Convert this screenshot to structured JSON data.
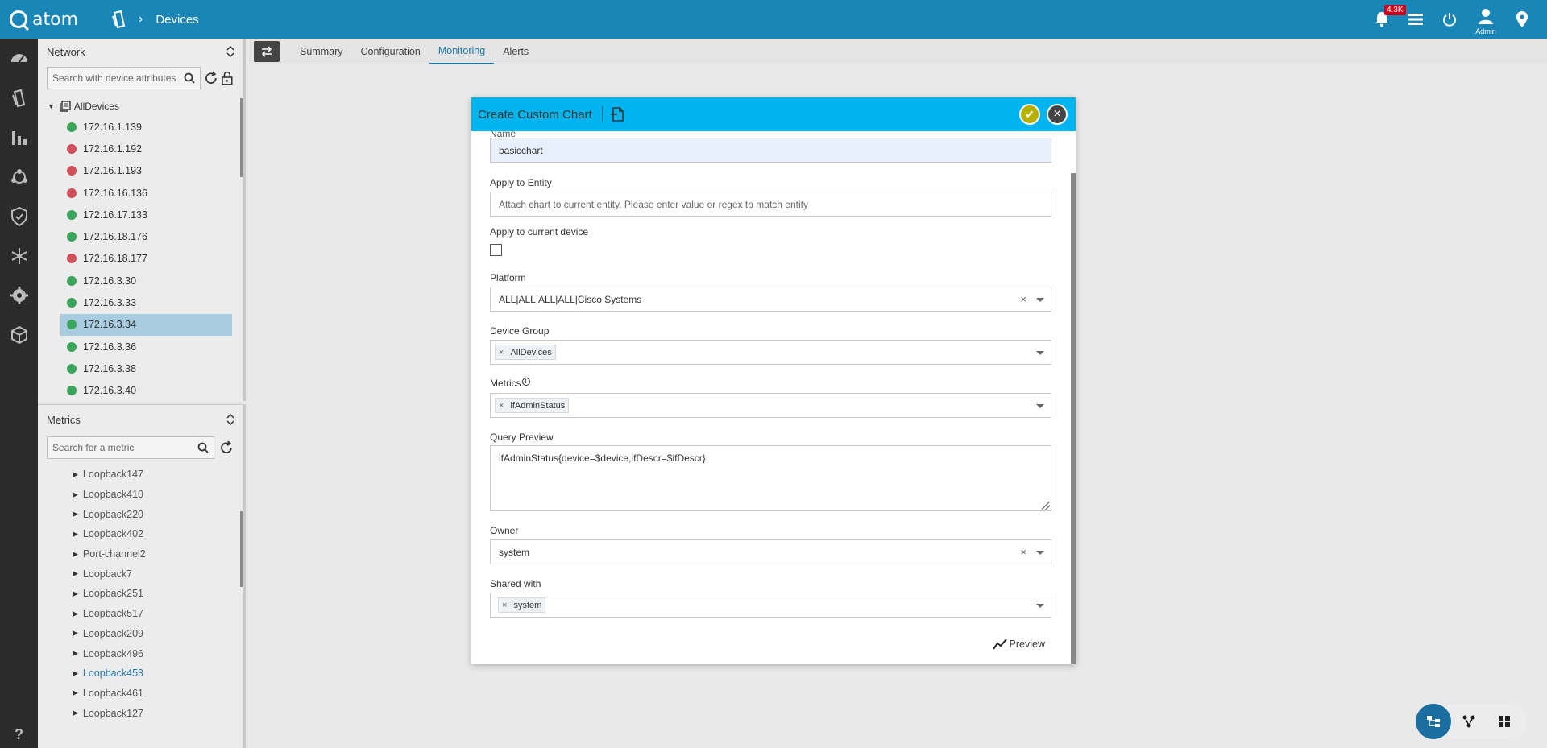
{
  "topbar": {
    "app_name": "atom",
    "breadcrumb": "Devices",
    "notification_count": "4.3K",
    "user_label": "Admin",
    "bg_color": "#1a86b8"
  },
  "network_panel": {
    "title": "Network",
    "search_placeholder": "Search with device attributes",
    "root_label": "AllDevices",
    "devices": [
      {
        "ip": "172.16.1.139",
        "status": "green"
      },
      {
        "ip": "172.16.1.192",
        "status": "red"
      },
      {
        "ip": "172.16.1.193",
        "status": "red"
      },
      {
        "ip": "172.16.16.136",
        "status": "red"
      },
      {
        "ip": "172.16.17.133",
        "status": "green"
      },
      {
        "ip": "172.16.18.176",
        "status": "green"
      },
      {
        "ip": "172.16.18.177",
        "status": "red"
      },
      {
        "ip": "172.16.3.30",
        "status": "green"
      },
      {
        "ip": "172.16.3.33",
        "status": "green"
      },
      {
        "ip": "172.16.3.34",
        "status": "green",
        "selected": true
      },
      {
        "ip": "172.16.3.36",
        "status": "green"
      },
      {
        "ip": "172.16.3.38",
        "status": "green"
      },
      {
        "ip": "172.16.3.40",
        "status": "green"
      }
    ]
  },
  "metrics_panel": {
    "title": "Metrics",
    "search_placeholder": "Search for a metric",
    "items": [
      "Loopback147",
      "Loopback410",
      "Loopback220",
      "Loopback402",
      "Port-channel2",
      "Loopback7",
      "Loopback251",
      "Loopback517",
      "Loopback209",
      "Loopback496",
      "Loopback453",
      "Loopback461",
      "Loopback127"
    ],
    "active_item": "Loopback453"
  },
  "tabs": [
    "Summary",
    "Configuration",
    "Monitoring",
    "Alerts"
  ],
  "active_tab": "Monitoring",
  "modal": {
    "title": "Create Custom Chart",
    "name_label": "Name",
    "name_value": "basicchart",
    "entity_label": "Apply to Entity",
    "entity_placeholder": "Attach chart to current entity. Please enter value or regex to match entity",
    "current_device_label": "Apply to current device",
    "platform_label": "Platform",
    "platform_value": "ALL|ALL|ALL|ALL|Cisco Systems",
    "device_group_label": "Device Group",
    "device_group_tag": "AllDevices",
    "metrics_label": "Metrics",
    "metrics_tag": "ifAdminStatus",
    "query_label": "Query Preview",
    "query_value": "ifAdminStatus{device=$device,ifDescr=$ifDescr}",
    "owner_label": "Owner",
    "owner_value": "system",
    "shared_label": "Shared with",
    "shared_tag": "system",
    "preview_label": "Preview",
    "header_color": "#00b4f0"
  }
}
